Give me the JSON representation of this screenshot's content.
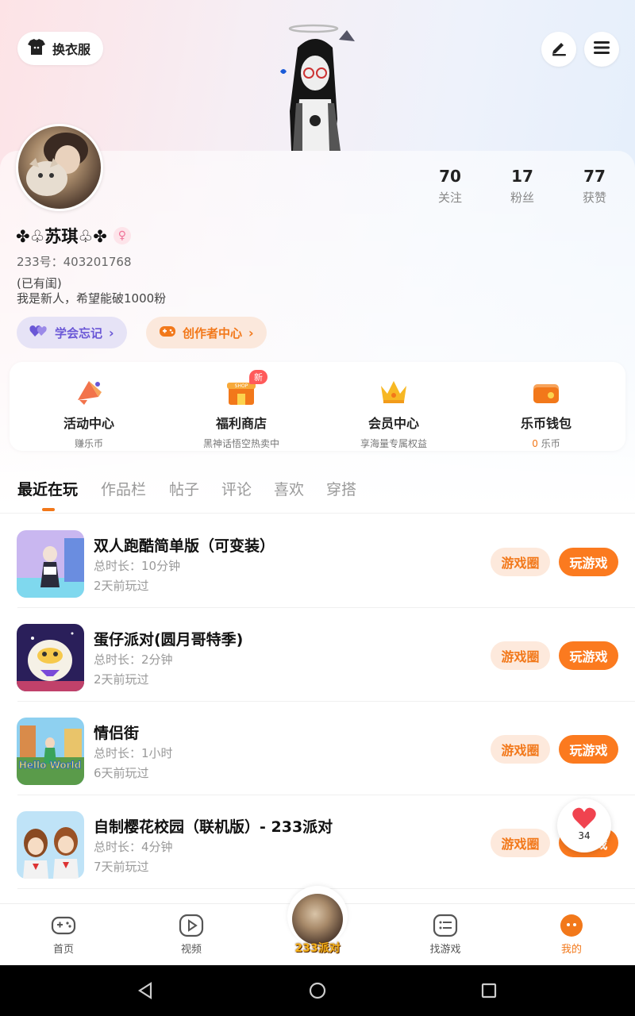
{
  "header": {
    "outfit_label": "换衣服",
    "edit_icon": "pen-icon",
    "menu_icon": "menu-icon"
  },
  "profile": {
    "name": "✤♧苏琪♧✤",
    "gender_symbol": "♀",
    "uid": "233号：403201768",
    "bio_line1": "(已有闺)",
    "bio_line2": "我是新人，希望能破1000粉",
    "stats": [
      {
        "num": "70",
        "label": "关注"
      },
      {
        "num": "17",
        "label": "粉丝"
      },
      {
        "num": "77",
        "label": "获赞"
      }
    ],
    "chip1": "学会忘记",
    "chip2": "创作者中心"
  },
  "quick_actions": [
    {
      "title": "活动中心",
      "sub": "赚乐币"
    },
    {
      "title": "福利商店",
      "sub": "黑神话悟空热卖中",
      "badge": "新",
      "icon_text": "SHOP"
    },
    {
      "title": "会员中心",
      "sub": "享海量专属权益"
    },
    {
      "title": "乐币钱包",
      "sub_hl": "0",
      "sub": " 乐币"
    }
  ],
  "tabs": [
    "最近在玩",
    "作品栏",
    "帖子",
    "评论",
    "喜欢",
    "穿搭"
  ],
  "games": [
    {
      "title": "双人跑酷简单版（可变装）",
      "duration": "总时长：10分钟",
      "last": "2天前玩过"
    },
    {
      "title": "蛋仔派对(圆月哥特季)",
      "duration": "总时长：2分钟",
      "last": "2天前玩过"
    },
    {
      "title": "情侣街",
      "duration": "总时长：1小时",
      "last": "6天前玩过",
      "thumb_text": "Hello World"
    },
    {
      "title": "自制樱花校园（联机版）- 233派对",
      "duration": "总时长：4分钟",
      "last": "7天前玩过"
    }
  ],
  "buttons": {
    "circle": "游戏圈",
    "play": "玩游戏"
  },
  "float_like": {
    "count": "34"
  },
  "nav": {
    "home": "首页",
    "video": "视频",
    "center": "233派对",
    "find": "找游戏",
    "me": "我的"
  },
  "colors": {
    "accent": "#f2781a",
    "accent_bg": "#fde9dc",
    "chip_purple": "#6a57d6"
  }
}
